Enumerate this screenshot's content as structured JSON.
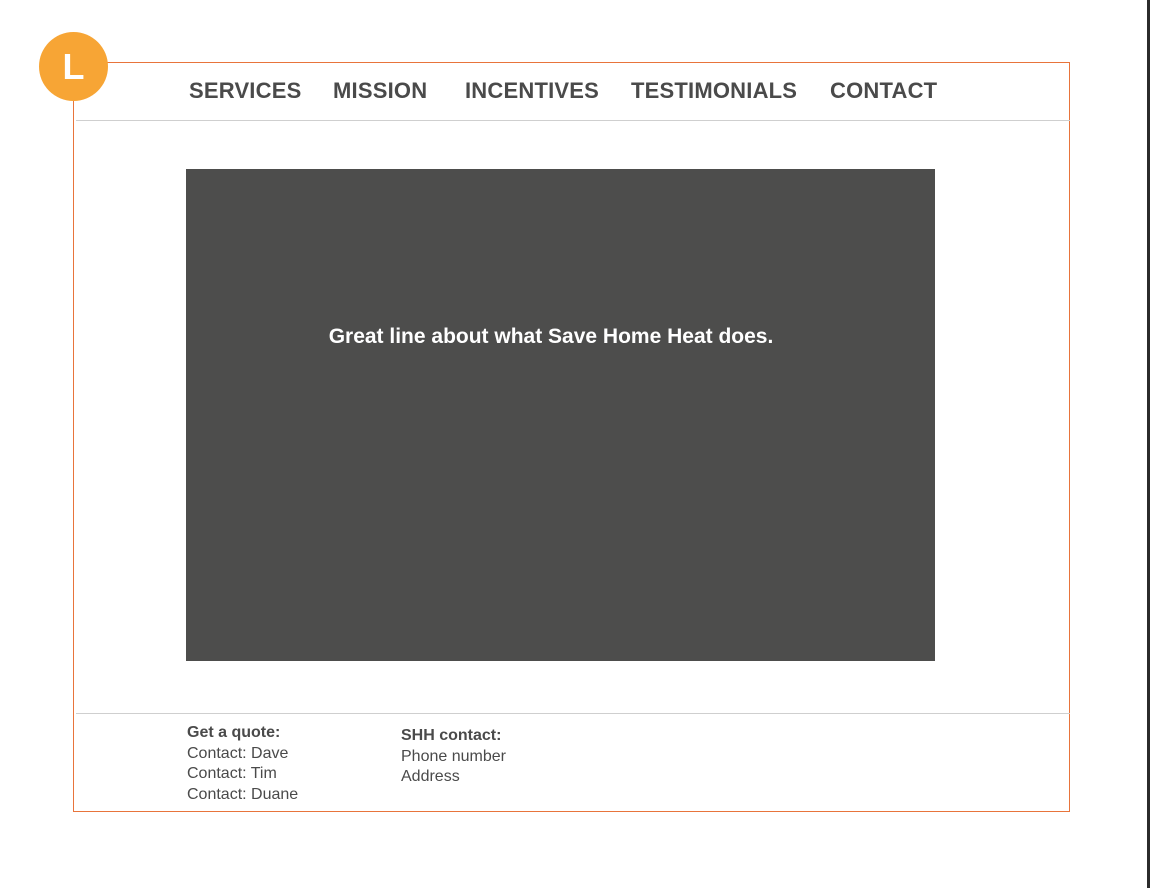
{
  "badge": {
    "letter": "L",
    "color": "#f7a535"
  },
  "frame": {
    "border_color": "#e8743b"
  },
  "nav": {
    "items": [
      {
        "label": "SERVICES"
      },
      {
        "label": "MISSION"
      },
      {
        "label": "INCENTIVES"
      },
      {
        "label": "TESTIMONIALS"
      },
      {
        "label": "CONTACT"
      }
    ]
  },
  "hero": {
    "headline": "Great line about what Save Home Heat does.",
    "background": "#4d4d4c"
  },
  "footer": {
    "quote": {
      "heading": "Get a quote:",
      "lines": [
        "Contact: Dave",
        "Contact: Tim",
        "Contact: Duane"
      ]
    },
    "shh_contact": {
      "heading": "SHH contact:",
      "lines": [
        "Phone number",
        "Address"
      ]
    }
  }
}
